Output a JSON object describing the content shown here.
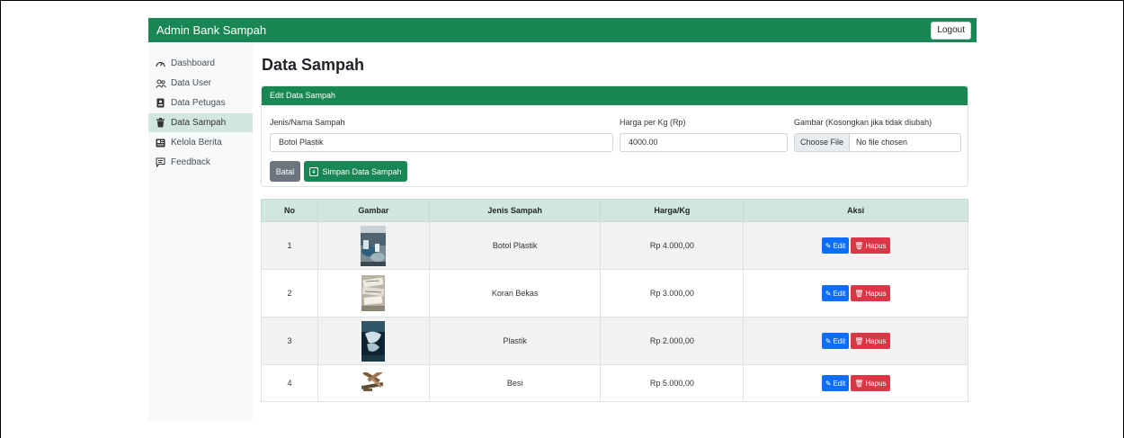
{
  "navbar": {
    "brand": "Admin Bank Sampah",
    "logout_label": "Logout"
  },
  "sidebar": {
    "items": [
      {
        "label": "Dashboard",
        "icon": "speedometer-icon",
        "active": false
      },
      {
        "label": "Data User",
        "icon": "people-icon",
        "active": false
      },
      {
        "label": "Data Petugas",
        "icon": "id-card-icon",
        "active": false
      },
      {
        "label": "Data Sampah",
        "icon": "trash-icon",
        "active": true
      },
      {
        "label": "Kelola Berita",
        "icon": "newspaper-icon",
        "active": false
      },
      {
        "label": "Feedback",
        "icon": "chat-icon",
        "active": false
      }
    ]
  },
  "page": {
    "title": "Data Sampah"
  },
  "form": {
    "header": "Edit Data Sampah",
    "name_label": "Jenis/Nama Sampah",
    "name_value": "Botol Plastik",
    "price_label": "Harga per Kg (Rp)",
    "price_value": "4000.00",
    "image_label": "Gambar (Kosongkan jika tidak diubah)",
    "file_button": "Choose File",
    "file_status": "No file chosen",
    "cancel_label": "Batal",
    "save_label": "Simpan Data Sampah"
  },
  "table": {
    "headers": [
      "No",
      "Gambar",
      "Jenis Sampah",
      "Harga/Kg",
      "Aksi"
    ],
    "edit_label": "Edit",
    "delete_label": "Hapus",
    "rows": [
      {
        "no": "1",
        "name": "Botol Plastik",
        "price": "Rp 4.000,00"
      },
      {
        "no": "2",
        "name": "Koran Bekas",
        "price": "Rp 3.000,00"
      },
      {
        "no": "3",
        "name": "Plastik",
        "price": "Rp 2.000,00"
      },
      {
        "no": "4",
        "name": "Besi",
        "price": "Rp 5.000,00"
      }
    ]
  },
  "colors": {
    "primary_green": "#198754",
    "header_tint": "#d1e7dd",
    "edit_blue": "#0d6efd",
    "delete_red": "#dc3545",
    "cancel_grey": "#6c757d"
  }
}
